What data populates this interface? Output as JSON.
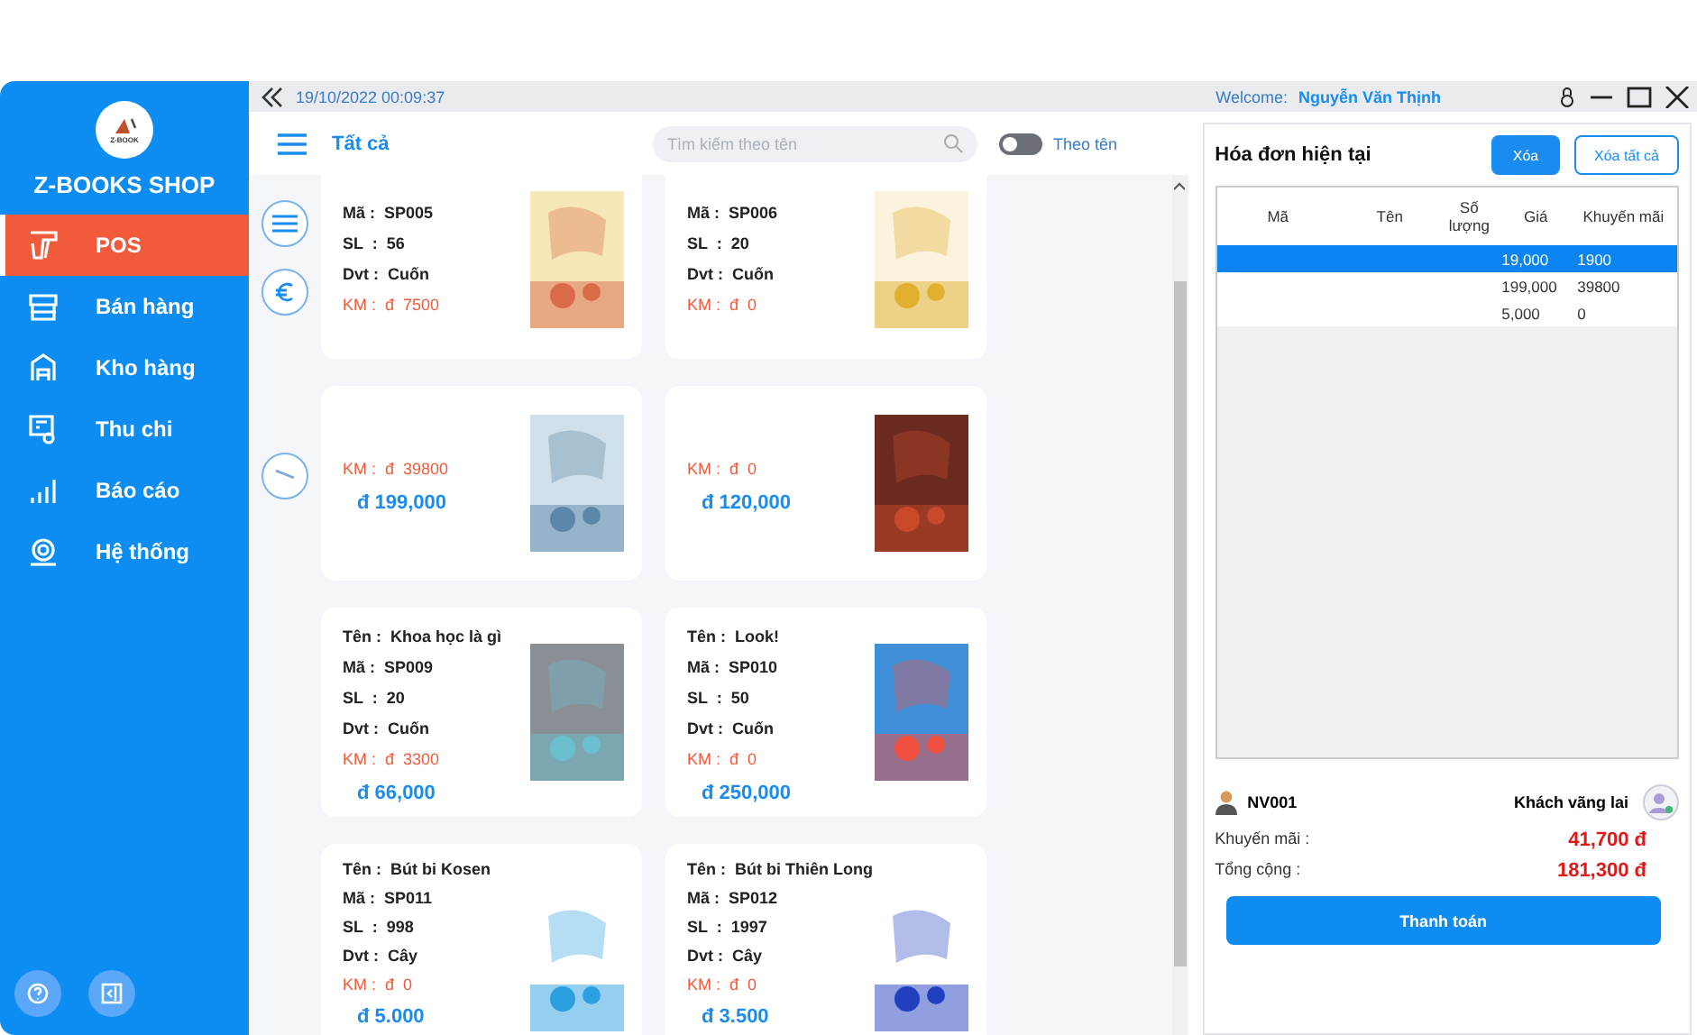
{
  "sidebar": {
    "shop_name": "Z-BOOKS SHOP",
    "logo_text": "Z-BOOK",
    "items": [
      {
        "label": "POS",
        "selected": true
      },
      {
        "label": "Bán hàng",
        "selected": false
      },
      {
        "label": "Kho hàng",
        "selected": false
      },
      {
        "label": "Thu chi",
        "selected": false
      },
      {
        "label": "Báo cáo",
        "selected": false
      },
      {
        "label": "Hệ thống",
        "selected": false
      }
    ]
  },
  "top_bar": {
    "datetime": "19/10/2022 00:09:37",
    "welcome_label": "Welcome:",
    "user_name": "Nguyễn Văn Thịnh"
  },
  "toolbar": {
    "category": "Tất cả",
    "search": {
      "placeholder": "Tìm kiếm theo tên"
    },
    "toggle": {
      "label": "Theo tên",
      "on": false
    }
  },
  "products": [
    {
      "fields": [
        {
          "label": "Mã :",
          "value": "SP005"
        },
        {
          "label": "SL  :",
          "value": "56"
        },
        {
          "label": "Dvt :",
          "value": "Cuốn"
        }
      ],
      "promo": {
        "label": "KM :",
        "value": "đ  7500"
      }
    },
    {
      "fields": [
        {
          "label": "Mã :",
          "value": "SP006"
        },
        {
          "label": "SL  :",
          "value": "20"
        },
        {
          "label": "Dvt :",
          "value": "Cuốn"
        }
      ],
      "promo": {
        "label": "KM :",
        "value": "đ  0"
      }
    },
    {
      "promo": {
        "label": "KM :",
        "value": "đ  39800"
      },
      "price": "đ 199,000"
    },
    {
      "promo": {
        "label": "KM :",
        "value": "đ  0"
      },
      "price": "đ 120,000"
    },
    {
      "fields": [
        {
          "label": "Tên :",
          "value": "Khoa học là gì"
        },
        {
          "label": "Mã :",
          "value": "SP009"
        },
        {
          "label": "SL  :",
          "value": "20"
        },
        {
          "label": "Dvt :",
          "value": "Cuốn"
        }
      ],
      "promo": {
        "label": "KM :",
        "value": "đ  3300"
      },
      "price": "đ 66,000"
    },
    {
      "fields": [
        {
          "label": "Tên :",
          "value": "Look!"
        },
        {
          "label": "Mã :",
          "value": "SP010"
        },
        {
          "label": "SL  :",
          "value": "50"
        },
        {
          "label": "Dvt :",
          "value": "Cuốn"
        }
      ],
      "promo": {
        "label": "KM :",
        "value": "đ  0"
      },
      "price": "đ 250,000"
    },
    {
      "fields": [
        {
          "label": "Tên :",
          "value": "Bút bi Kosen"
        },
        {
          "label": "Mã :",
          "value": "SP011"
        },
        {
          "label": "SL  :",
          "value": "998"
        },
        {
          "label": "Dvt :",
          "value": "Cây"
        }
      ],
      "promo": {
        "label": "KM :",
        "value": "đ  0"
      },
      "price": "đ 5.000"
    },
    {
      "fields": [
        {
          "label": "Tên :",
          "value": "Bút bi Thiên Long"
        },
        {
          "label": "Mã :",
          "value": "SP012"
        },
        {
          "label": "SL  :",
          "value": "1997"
        },
        {
          "label": "Dvt :",
          "value": "Cây"
        }
      ],
      "promo": {
        "label": "KM :",
        "value": "đ  0"
      },
      "price": "đ 3.500"
    }
  ],
  "invoice": {
    "title": "Hóa đơn hiện tại",
    "buttons": [
      {
        "label": "Xóa",
        "kind": "primary"
      },
      {
        "label": "Xóa tất cả",
        "kind": "outline"
      }
    ],
    "columns": [
      "Mã",
      "Tên",
      "Số lượng",
      "Giá",
      "Khuyến mãi"
    ],
    "rows": [
      {
        "price": "19,000",
        "promo": "1900",
        "selected": true
      },
      {
        "price": "199,000",
        "promo": "39800",
        "selected": false
      },
      {
        "price": "5,000",
        "promo": "0",
        "selected": false
      }
    ],
    "staff": "NV001",
    "customer": "Khách vãng lai",
    "totals": [
      {
        "label": "Khuyến mãi :",
        "value": "41,700  đ"
      },
      {
        "label": "Tổng cộng :",
        "value": "181,300  đ"
      }
    ],
    "pay_button": "Thanh toán"
  }
}
